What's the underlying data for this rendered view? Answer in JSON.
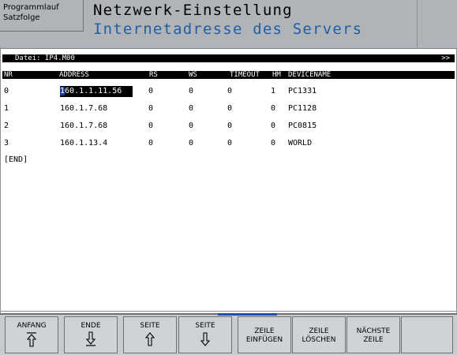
{
  "header": {
    "mode_line1": "Programmlauf",
    "mode_line2": "Satzfolge",
    "title": "Netzwerk-Einstellung",
    "subtitle": "Internetadresse des Servers"
  },
  "file": {
    "label": "Datei: IP4.M00",
    "more": ">>"
  },
  "table": {
    "headers": {
      "nr": "NR",
      "address": "ADDRESS",
      "rs": "RS",
      "ws": "WS",
      "timeout": "TIMEOUT",
      "hm": "HM",
      "devicename": "DEVICENAME"
    },
    "rows": [
      {
        "nr": "0",
        "address_first": "1",
        "address_rest": "60.1.1.11.56",
        "rs": "0",
        "ws": "0",
        "timeout": "0",
        "hm": "1",
        "devicename": "PC1331"
      },
      {
        "nr": "1",
        "address": "160.1.7.68",
        "rs": "0",
        "ws": "0",
        "timeout": "0",
        "hm": "0",
        "devicename": "PC1128"
      },
      {
        "nr": "2",
        "address": "160.1.7.68",
        "rs": "0",
        "ws": "0",
        "timeout": "0",
        "hm": "0",
        "devicename": "PC0815"
      },
      {
        "nr": "3",
        "address": "160.1.13.4",
        "rs": "0",
        "ws": "0",
        "timeout": "0",
        "hm": "0",
        "devicename": "WORLD"
      }
    ],
    "end_marker": "[END]"
  },
  "softkeys": {
    "anfang": {
      "label": "ANFANG",
      "icon": "arrow-up-to-top-icon"
    },
    "ende": {
      "label": "ENDE",
      "icon": "arrow-down-to-bottom-icon"
    },
    "seite_up": {
      "label": "SEITE",
      "icon": "page-up-icon"
    },
    "seite_down": {
      "label": "SEITE",
      "icon": "page-down-icon"
    },
    "zeile_einfuegen": {
      "line1": "ZEILE",
      "line2": "EINFÜGEN"
    },
    "zeile_loeschen": {
      "line1": "ZEILE",
      "line2": "LÖSCHEN"
    },
    "naechste_zeile": {
      "line1": "NÄCHSTE",
      "line2": "ZEILE"
    }
  },
  "colors": {
    "header_bg": "#b0b4b8",
    "subtitle": "#1f5fa8",
    "cursor": "#1a3fa6",
    "softkey_bg": "#d0d3d6"
  }
}
